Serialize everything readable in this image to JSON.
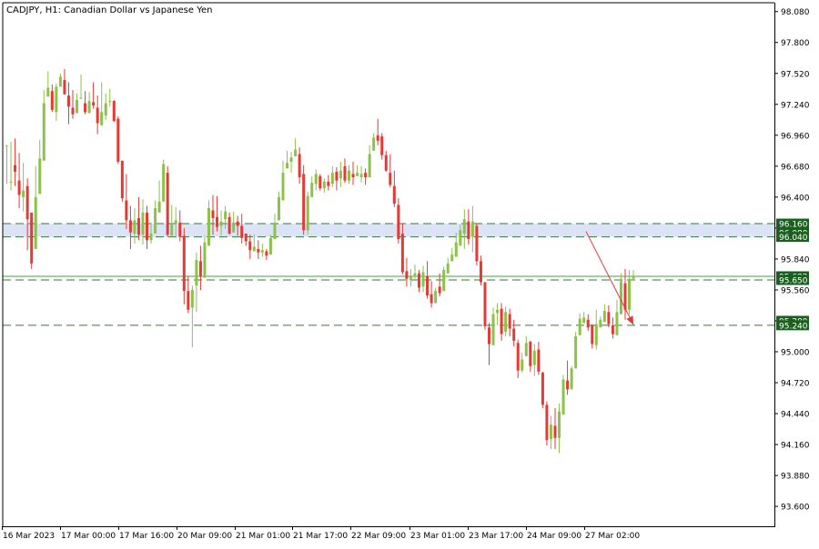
{
  "header": {
    "symbol": "CADJPY",
    "timeframe": "H1",
    "description": "Canadian Dollar vs Japanese Yen",
    "title": "CADJPY, H1:  Canadian Dollar vs Japanese Yen"
  },
  "colors": {
    "bull": "#8bc34a",
    "bear": "#e53935",
    "level_line": "#2e7d32",
    "current_price_line": "#43a047",
    "zone_fill": "#dde3f6",
    "axis": "#000000",
    "label_bg": "#1b5e20",
    "label_text": "#ffffff",
    "arrow": "#e53935"
  },
  "chart_data": {
    "type": "candlestick",
    "title": "CADJPY, H1:  Canadian Dollar vs Japanese Yen",
    "ylim": [
      93.42,
      98.16
    ],
    "y_ticks": [
      "98.080",
      "97.800",
      "97.520",
      "97.240",
      "96.960",
      "96.680",
      "96.400",
      "96.120",
      "95.840",
      "95.560",
      "95.280",
      "95.000",
      "94.720",
      "94.440",
      "94.160",
      "93.880",
      "93.600"
    ],
    "x_labels": [
      "16 Mar 2023",
      "17 Mar 00:00",
      "17 Mar 16:00",
      "20 Mar 09:00",
      "21 Mar 01:00",
      "21 Mar 17:00",
      "22 Mar 09:00",
      "23 Mar 01:00",
      "23 Mar 17:00",
      "24 Mar 09:00",
      "27 Mar 02:00"
    ],
    "price_labels": [
      {
        "text": "96.160",
        "value": 96.16
      },
      {
        "text": "96.080",
        "value": 96.08
      },
      {
        "text": "96.040",
        "value": 96.04
      },
      {
        "text": "95.683",
        "value": 95.683
      },
      {
        "text": "95.650",
        "value": 95.65
      },
      {
        "text": "95.280",
        "value": 95.28
      },
      {
        "text": "95.240",
        "value": 95.24
      }
    ],
    "zone": [
      96.04,
      96.16
    ],
    "dashed_levels": [
      96.16,
      96.04,
      95.65,
      95.24
    ],
    "current_price": 95.683,
    "arrow": {
      "from_bar": 140.5,
      "from_price": 96.09,
      "to_bar": 152,
      "to_price": 95.245
    },
    "candles": [
      [
        96.87,
        96.52,
        96.87,
        96.87
      ],
      [
        96.53,
        96.46,
        96.9,
        96.54
      ],
      [
        96.69,
        96.5,
        96.93,
        96.63
      ],
      [
        96.55,
        96.3,
        96.8,
        96.42
      ],
      [
        96.4,
        96.27,
        96.71,
        96.46
      ],
      [
        96.5,
        95.92,
        96.57,
        96.2
      ],
      [
        96.26,
        95.75,
        96.26,
        95.8
      ],
      [
        95.93,
        95.93,
        96.68,
        96.4
      ],
      [
        96.43,
        96.43,
        96.92,
        96.75
      ],
      [
        96.73,
        96.73,
        97.37,
        97.25
      ],
      [
        97.31,
        97.31,
        97.54,
        97.39
      ],
      [
        97.36,
        97.17,
        97.42,
        97.19
      ],
      [
        97.17,
        97.09,
        97.43,
        97.4
      ],
      [
        97.4,
        97.4,
        97.52,
        97.49
      ],
      [
        97.46,
        97.33,
        97.56,
        97.33
      ],
      [
        97.32,
        97.06,
        97.44,
        97.22
      ],
      [
        97.21,
        97.11,
        97.37,
        97.15
      ],
      [
        97.16,
        97.16,
        97.34,
        97.28
      ],
      [
        97.29,
        97.29,
        97.51,
        97.3
      ],
      [
        97.25,
        97.15,
        97.36,
        97.17
      ],
      [
        97.16,
        97.16,
        97.35,
        97.27
      ],
      [
        97.26,
        97.2,
        97.44,
        97.23
      ],
      [
        97.21,
        96.97,
        97.32,
        97.07
      ],
      [
        97.05,
        97.05,
        97.44,
        97.17
      ],
      [
        97.14,
        97.1,
        97.34,
        97.25
      ],
      [
        97.26,
        97.22,
        97.38,
        97.27
      ],
      [
        97.27,
        97.08,
        97.28,
        97.09
      ],
      [
        97.11,
        96.7,
        97.13,
        96.72
      ],
      [
        96.73,
        96.36,
        96.73,
        96.39
      ],
      [
        96.37,
        96.11,
        96.61,
        96.19
      ],
      [
        96.19,
        95.93,
        96.32,
        96.08
      ],
      [
        96.07,
        95.98,
        96.3,
        96.19
      ],
      [
        96.21,
        96.01,
        96.4,
        96.06
      ],
      [
        96.06,
        95.97,
        96.38,
        96.26
      ],
      [
        96.26,
        95.93,
        96.32,
        96.01
      ],
      [
        96.01,
        95.98,
        96.17,
        96.07
      ],
      [
        96.07,
        96.07,
        96.37,
        96.3
      ],
      [
        96.26,
        96.26,
        96.55,
        96.36
      ],
      [
        96.36,
        96.36,
        96.74,
        96.7
      ],
      [
        96.62,
        96.04,
        96.68,
        96.06
      ],
      [
        96.05,
        96.05,
        96.33,
        96.15
      ],
      [
        96.16,
        96.03,
        96.31,
        96.19
      ],
      [
        96.17,
        96.0,
        96.28,
        96.04
      ],
      [
        96.05,
        95.43,
        96.12,
        95.55
      ],
      [
        95.55,
        95.35,
        95.68,
        95.38
      ],
      [
        95.4,
        95.04,
        95.6,
        95.56
      ],
      [
        95.6,
        95.36,
        95.9,
        95.83
      ],
      [
        95.82,
        95.56,
        95.96,
        95.68
      ],
      [
        95.67,
        95.67,
        96.05,
        95.99
      ],
      [
        95.96,
        95.96,
        96.37,
        96.3
      ],
      [
        96.28,
        96.06,
        96.42,
        96.21
      ],
      [
        96.22,
        96.09,
        96.41,
        96.13
      ],
      [
        96.14,
        96.05,
        96.28,
        96.18
      ],
      [
        96.2,
        96.11,
        96.32,
        96.27
      ],
      [
        96.22,
        96.06,
        96.26,
        96.07
      ],
      [
        96.08,
        96.08,
        96.27,
        96.17
      ],
      [
        96.18,
        96.05,
        96.23,
        96.14
      ],
      [
        96.14,
        95.98,
        96.25,
        96.03
      ],
      [
        96.07,
        95.96,
        96.07,
        96.0
      ],
      [
        96.0,
        95.84,
        96.06,
        95.92
      ],
      [
        95.91,
        95.91,
        96.06,
        95.95
      ],
      [
        95.93,
        95.84,
        96.01,
        95.9
      ],
      [
        95.9,
        95.86,
        95.98,
        95.92
      ],
      [
        95.91,
        95.83,
        95.93,
        95.87
      ],
      [
        95.88,
        95.88,
        96.06,
        96.03
      ],
      [
        96.02,
        96.02,
        96.25,
        96.16
      ],
      [
        96.19,
        96.19,
        96.45,
        96.4
      ],
      [
        96.37,
        96.37,
        96.73,
        96.62
      ],
      [
        96.66,
        96.66,
        96.82,
        96.71
      ],
      [
        96.72,
        96.62,
        96.81,
        96.76
      ],
      [
        96.77,
        96.77,
        96.93,
        96.83
      ],
      [
        96.79,
        96.52,
        96.85,
        96.58
      ],
      [
        96.61,
        96.06,
        96.69,
        96.1
      ],
      [
        96.1,
        96.06,
        96.45,
        96.41
      ],
      [
        96.4,
        96.4,
        96.59,
        96.53
      ],
      [
        96.52,
        96.46,
        96.65,
        96.61
      ],
      [
        96.59,
        96.46,
        96.61,
        96.48
      ],
      [
        96.48,
        96.44,
        96.57,
        96.54
      ],
      [
        96.54,
        96.46,
        96.6,
        96.5
      ],
      [
        96.52,
        96.49,
        96.68,
        96.62
      ],
      [
        96.63,
        96.46,
        96.67,
        96.55
      ],
      [
        96.57,
        96.49,
        96.72,
        96.64
      ],
      [
        96.68,
        96.53,
        96.75,
        96.55
      ],
      [
        96.55,
        96.52,
        96.69,
        96.64
      ],
      [
        96.61,
        96.51,
        96.72,
        96.58
      ],
      [
        96.59,
        96.59,
        96.69,
        96.62
      ],
      [
        96.58,
        96.53,
        96.68,
        96.61
      ],
      [
        96.62,
        96.51,
        96.66,
        96.58
      ],
      [
        96.58,
        96.58,
        96.87,
        96.79
      ],
      [
        96.82,
        96.82,
        96.98,
        96.94
      ],
      [
        96.96,
        96.87,
        97.11,
        96.91
      ],
      [
        96.95,
        96.74,
        96.98,
        96.78
      ],
      [
        96.78,
        96.63,
        96.82,
        96.64
      ],
      [
        96.62,
        96.49,
        96.79,
        96.51
      ],
      [
        96.5,
        96.31,
        96.64,
        96.34
      ],
      [
        96.33,
        95.98,
        96.39,
        96.02
      ],
      [
        96.07,
        95.7,
        96.16,
        95.72
      ],
      [
        95.73,
        95.59,
        95.85,
        95.66
      ],
      [
        95.65,
        95.59,
        95.75,
        95.69
      ],
      [
        95.68,
        95.66,
        95.79,
        95.71
      ],
      [
        95.71,
        95.54,
        95.74,
        95.58
      ],
      [
        95.59,
        95.54,
        95.78,
        95.72
      ],
      [
        95.68,
        95.48,
        95.82,
        95.51
      ],
      [
        95.52,
        95.4,
        95.64,
        95.44
      ],
      [
        95.44,
        95.44,
        95.58,
        95.55
      ],
      [
        95.59,
        95.5,
        95.71,
        95.53
      ],
      [
        95.55,
        95.55,
        95.77,
        95.74
      ],
      [
        95.71,
        95.71,
        95.85,
        95.8
      ],
      [
        95.82,
        95.82,
        95.94,
        95.88
      ],
      [
        95.86,
        95.86,
        96.08,
        95.99
      ],
      [
        95.96,
        95.96,
        96.15,
        96.1
      ],
      [
        96.07,
        95.93,
        96.29,
        96.2
      ],
      [
        96.18,
        95.97,
        96.29,
        96.02
      ],
      [
        96.04,
        95.9,
        96.32,
        96.18
      ],
      [
        96.14,
        95.78,
        96.16,
        95.82
      ],
      [
        95.82,
        95.6,
        95.87,
        95.63
      ],
      [
        95.63,
        95.2,
        95.63,
        95.23
      ],
      [
        95.22,
        94.88,
        95.26,
        95.07
      ],
      [
        95.06,
        95.06,
        95.4,
        95.34
      ],
      [
        95.35,
        95.24,
        95.44,
        95.38
      ],
      [
        95.39,
        95.1,
        95.44,
        95.16
      ],
      [
        95.18,
        95.14,
        95.41,
        95.36
      ],
      [
        95.34,
        95.14,
        95.39,
        95.21
      ],
      [
        95.21,
        95.05,
        95.29,
        95.1
      ],
      [
        95.08,
        94.76,
        95.11,
        94.83
      ],
      [
        94.83,
        94.81,
        94.99,
        94.93
      ],
      [
        94.96,
        94.96,
        95.14,
        95.08
      ],
      [
        95.09,
        94.82,
        95.1,
        94.87
      ],
      [
        94.88,
        94.78,
        95.07,
        95.01
      ],
      [
        95.02,
        94.79,
        95.09,
        94.82
      ],
      [
        94.81,
        94.49,
        94.82,
        94.52
      ],
      [
        94.52,
        94.15,
        94.55,
        94.2
      ],
      [
        94.21,
        94.12,
        94.42,
        94.34
      ],
      [
        94.33,
        94.12,
        94.49,
        94.22
      ],
      [
        94.22,
        94.08,
        94.53,
        94.46
      ],
      [
        94.43,
        94.43,
        94.79,
        94.75
      ],
      [
        94.74,
        94.61,
        94.92,
        94.66
      ],
      [
        94.66,
        94.66,
        94.87,
        94.85
      ],
      [
        94.85,
        94.85,
        95.18,
        95.14
      ],
      [
        95.15,
        95.15,
        95.35,
        95.3
      ],
      [
        95.26,
        95.26,
        95.36,
        95.31
      ],
      [
        95.29,
        95.19,
        95.34,
        95.22
      ],
      [
        95.24,
        95.03,
        95.25,
        95.07
      ],
      [
        95.06,
        95.02,
        95.38,
        95.25
      ],
      [
        95.22,
        95.22,
        95.32,
        95.29
      ],
      [
        95.27,
        95.27,
        95.43,
        95.37
      ],
      [
        95.36,
        95.22,
        95.42,
        95.25
      ],
      [
        95.24,
        95.12,
        95.31,
        95.16
      ],
      [
        95.15,
        95.15,
        95.47,
        95.36
      ],
      [
        95.34,
        95.34,
        95.71,
        95.64
      ],
      [
        95.62,
        95.29,
        95.75,
        95.38
      ],
      [
        95.38,
        95.34,
        95.74,
        95.66
      ],
      [
        95.66,
        95.66,
        95.74,
        95.69
      ]
    ]
  }
}
